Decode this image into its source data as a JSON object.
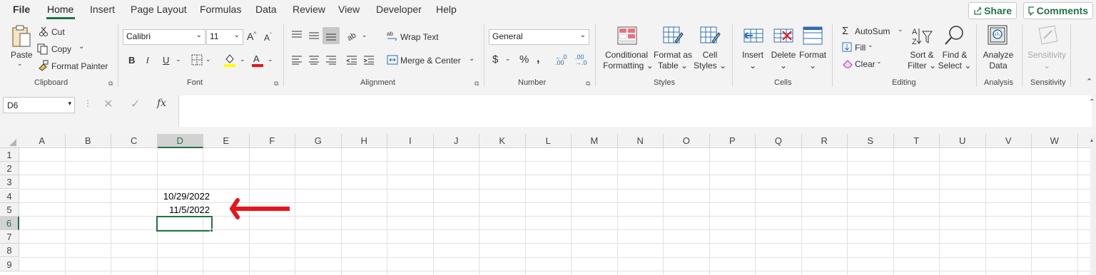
{
  "menu": {
    "items": [
      "File",
      "Home",
      "Insert",
      "Page Layout",
      "Formulas",
      "Data",
      "Review",
      "View",
      "Developer",
      "Help"
    ],
    "share_label": "Share",
    "comments_label": "Comments"
  },
  "ribbon": {
    "clipboard": {
      "paste": "Paste",
      "cut": "Cut",
      "copy": "Copy",
      "format_painter": "Format Painter",
      "label": "Clipboard"
    },
    "font": {
      "font_name": "Calibri",
      "font_size": "11",
      "label": "Font"
    },
    "alignment": {
      "wrap_text": "Wrap Text",
      "merge_center": "Merge & Center",
      "label": "Alignment"
    },
    "number": {
      "format": "General",
      "label": "Number"
    },
    "styles": {
      "conditional_1": "Conditional",
      "conditional_2": "Formatting",
      "format_table_1": "Format as",
      "format_table_2": "Table",
      "cell_styles_1": "Cell",
      "cell_styles_2": "Styles",
      "label": "Styles"
    },
    "cells": {
      "insert": "Insert",
      "delete": "Delete",
      "format": "Format",
      "label": "Cells"
    },
    "editing": {
      "autosum": "AutoSum",
      "fill": "Fill",
      "clear": "Clear",
      "sort_1": "Sort &",
      "sort_2": "Filter",
      "find_1": "Find &",
      "find_2": "Select",
      "label": "Editing"
    },
    "analysis": {
      "analyze_1": "Analyze",
      "analyze_2": "Data",
      "label": "Analysis"
    },
    "sensitivity": {
      "button": "Sensitivity",
      "label": "Sensitivity"
    }
  },
  "formula_bar": {
    "name_box": "D6",
    "fx": "fx",
    "content": ""
  },
  "sheet": {
    "columns": [
      "A",
      "B",
      "C",
      "D",
      "E",
      "F",
      "G",
      "H",
      "I",
      "J",
      "K",
      "L",
      "M",
      "N",
      "O",
      "P",
      "Q",
      "R",
      "S",
      "T",
      "U",
      "V",
      "W"
    ],
    "rows": [
      "1",
      "2",
      "3",
      "4",
      "5",
      "6",
      "7",
      "8",
      "9"
    ],
    "cells": {
      "D4": "10/29/2022",
      "D5": "11/5/2022"
    },
    "active_cell": "D6",
    "arrow_color": "#e8141c"
  },
  "colors": {
    "accent": "#217346"
  }
}
